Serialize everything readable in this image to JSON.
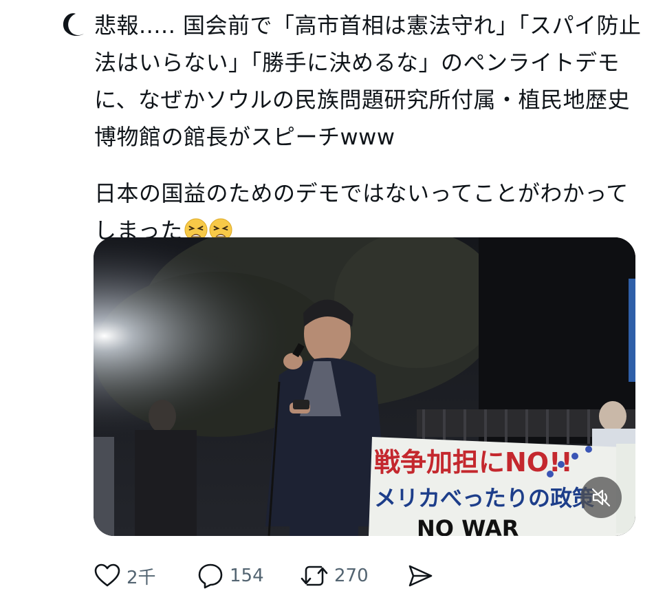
{
  "post": {
    "author_icon": "crescent-moon-icon",
    "text_lines": [
      "悲報..... 国会前で「高市首相は憲法守れ」「スパイ防止",
      "法はいらない」「勝手に決めるな」のペンライトデモ",
      "に、なぜかソウルの民族問題研究所付属・植民地歴史",
      "博物館の館長がスピーチwww"
    ],
    "text_line_2": "日本の国益のためのデモではないってことがわかって",
    "text_line_3": "しまった",
    "emoji": [
      "weary-face-emoji",
      "weary-face-emoji"
    ]
  },
  "media": {
    "type": "video",
    "banner_text_line1": "戦争加担にNO!!",
    "banner_text_line2": "メリカべったりの政策",
    "banner_text_line3": "NO WAR",
    "mute_icon": "speaker-muted-icon"
  },
  "actions": {
    "like_count": "2千",
    "reply_count": "154",
    "repost_count": "270",
    "icons": [
      "heart-icon",
      "reply-bubble-icon",
      "repost-icon",
      "share-icon"
    ]
  },
  "colors": {
    "text": "#0f1419",
    "muted": "#536471",
    "background": "#ffffff"
  }
}
